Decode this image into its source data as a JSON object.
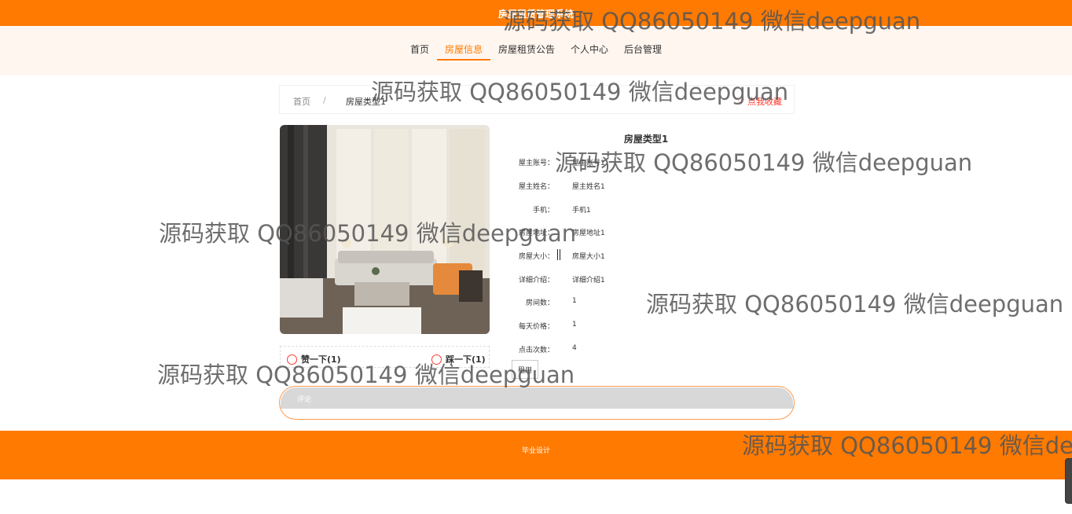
{
  "header": {
    "title": "房屋租赁管理系统"
  },
  "nav": {
    "items": [
      "首页",
      "房屋信息",
      "房屋租赁公告",
      "个人中心",
      "后台管理"
    ],
    "active_index": 1
  },
  "breadcrumb": {
    "home": "首页",
    "separator": "/",
    "current": "房屋类型1",
    "favorite": "点我收藏"
  },
  "detail": {
    "title": "房屋类型1",
    "fields": [
      {
        "label": "屋主账号：",
        "value": "屋主账号1"
      },
      {
        "label": "屋主姓名：",
        "value": "屋主姓名1"
      },
      {
        "label": "手机：",
        "value": "手机1"
      },
      {
        "label": "房屋地址：",
        "value": "房屋地址1"
      },
      {
        "label": "房屋大小：",
        "value": "房屋大小1"
      },
      {
        "label": "详细介绍：",
        "value": "详细介绍1"
      },
      {
        "label": "房间数：",
        "value": "1"
      },
      {
        "label": "每天价格：",
        "value": "1"
      },
      {
        "label": "点击次数：",
        "value": "4"
      }
    ],
    "button_label": "租用"
  },
  "votes": {
    "like": "赞一下(1)",
    "dislike": "踩一下(1)"
  },
  "comment": {
    "placeholder": "评论"
  },
  "footer": {
    "text": "毕业设计"
  },
  "watermark": "源码获取 QQ86050149 微信deepguan",
  "colors": {
    "brand": "#ff7a00",
    "nav_bg": "#fff6ef",
    "favorite": "#ff3b30"
  }
}
